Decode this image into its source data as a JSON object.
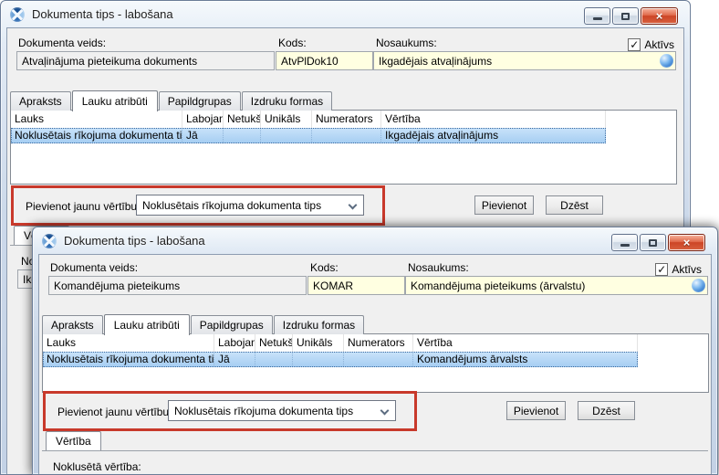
{
  "icons": {
    "close": "×",
    "check": "✓"
  },
  "annotations": {
    "highlight_color": "#c8392b"
  },
  "windows": [
    {
      "title": "Dokumenta tips - labošana",
      "fields": {
        "doc_type_label": "Dokumenta veids:",
        "doc_type_value": "Atvaļinājuma pieteikuma dokuments",
        "code_label": "Kods:",
        "code_value": "AtvPlDok10",
        "name_label": "Nosaukums:",
        "name_value": "Ikgadējais atvaļinājums",
        "active_label": "Aktīvs",
        "active_checked": true
      },
      "tabs": [
        "Apraksts",
        "Lauku atribūti",
        "Papildgrupas",
        "Izdruku formas"
      ],
      "active_tab": "Lauku atribūti",
      "table": {
        "columns": [
          "Lauks",
          "Labojams",
          "Netukšs",
          "Unikāls",
          "Numerators",
          "Vērtība"
        ],
        "row": [
          "Noklusētais rīkojuma dokumenta tips",
          "Jā",
          "",
          "",
          "",
          "Ikgadējais atvaļinājums"
        ]
      },
      "add_value": {
        "label": "Pievienot jaunu vērtību:",
        "selected": "Noklusētais rīkojuma dokumenta tips"
      },
      "buttons": {
        "add": "Pievienot",
        "delete": "Dzēst"
      },
      "bottom": {
        "tab": "Vērtība",
        "default_label": "Noklusētā vērtība:",
        "default_value": "Ikgadējais atvaļinājums"
      }
    },
    {
      "title": "Dokumenta tips - labošana",
      "fields": {
        "doc_type_label": "Dokumenta veids:",
        "doc_type_value": "Komandējuma pieteikums",
        "code_label": "Kods:",
        "code_value": "KOMAR",
        "name_label": "Nosaukums:",
        "name_value": "Komandējuma pieteikums (ārvalstu)",
        "active_label": "Aktīvs",
        "active_checked": true
      },
      "tabs": [
        "Apraksts",
        "Lauku atribūti",
        "Papildgrupas",
        "Izdruku formas"
      ],
      "active_tab": "Lauku atribūti",
      "table": {
        "columns": [
          "Lauks",
          "Labojams",
          "Netukšs",
          "Unikāls",
          "Numerators",
          "Vērtība"
        ],
        "row": [
          "Noklusētais rīkojuma dokumenta tips",
          "Jā",
          "",
          "",
          "",
          "Komandējums ārvalsts"
        ]
      },
      "add_value": {
        "label": "Pievienot jaunu vērtību:",
        "selected": "Noklusētais rīkojuma dokumenta tips"
      },
      "buttons": {
        "add": "Pievienot",
        "delete": "Dzēst"
      },
      "bottom": {
        "tab": "Vērtība",
        "default_label": "Noklusētā vērtība:"
      }
    }
  ]
}
